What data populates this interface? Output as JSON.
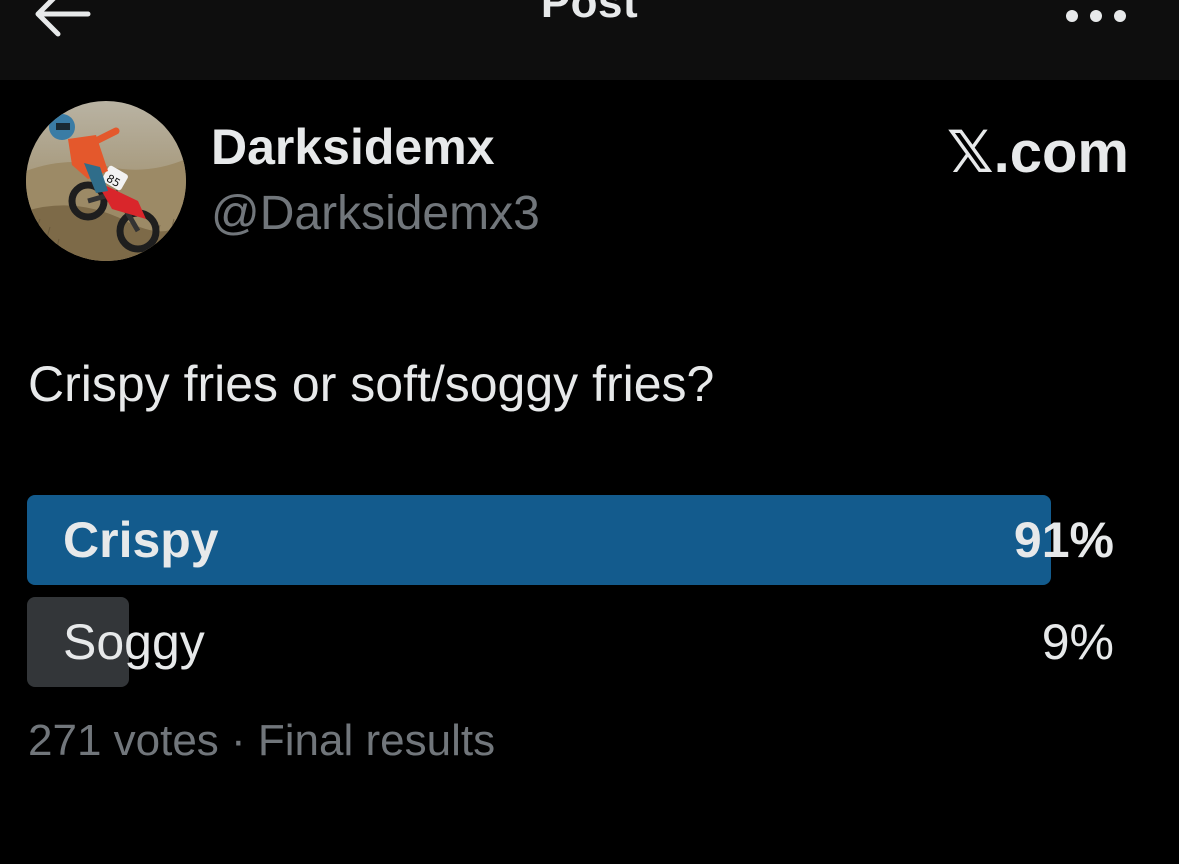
{
  "header": {
    "title": "Post",
    "back_icon": "arrow-left-icon",
    "more_icon": "more-horizontal-icon"
  },
  "author": {
    "display_name": "Darksidemx",
    "handle": "@Darksidemx3",
    "avatar": "motocross-rider-avatar"
  },
  "brand": {
    "text": "𝕏.com"
  },
  "post": {
    "text": "Crispy fries or soft/soggy fries?"
  },
  "poll": {
    "options": [
      {
        "label": "Crispy",
        "percent_text": "91%",
        "percent": 91,
        "winner": true
      },
      {
        "label": "Soggy",
        "percent_text": "9%",
        "percent": 9,
        "winner": false
      }
    ],
    "footer": "271 votes · Final results"
  },
  "colors": {
    "background": "#000000",
    "winner_bar": "#135b8d",
    "loser_bar": "#333639",
    "primary_text": "#e7e9ea",
    "secondary_text": "#71767b"
  }
}
